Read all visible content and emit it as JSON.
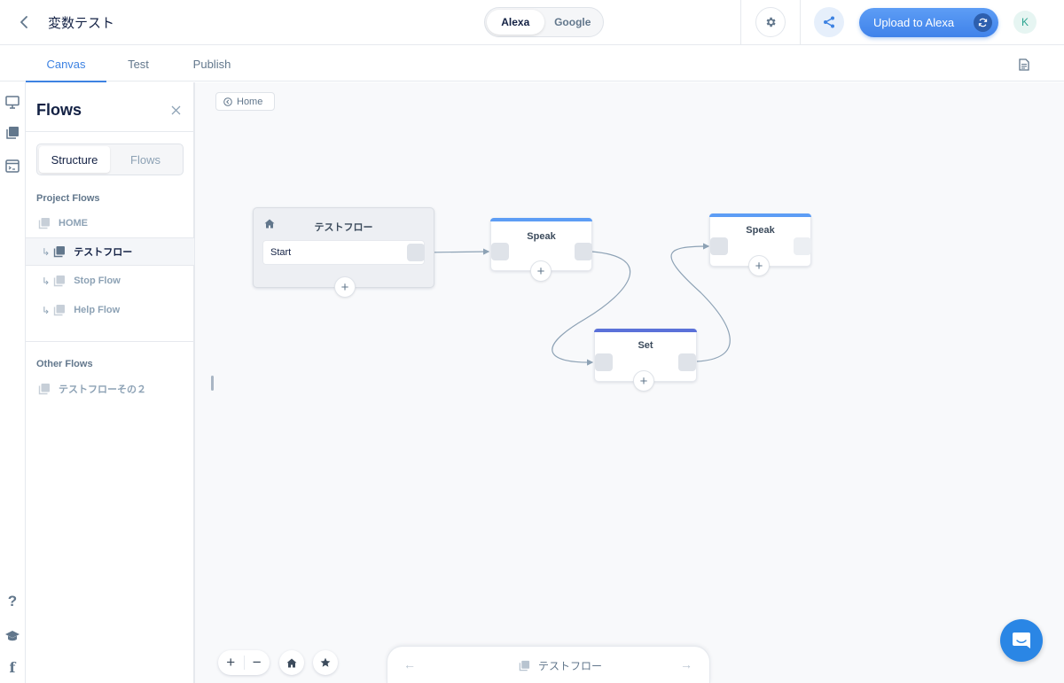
{
  "header": {
    "project_title": "変数テスト",
    "platforms": [
      "Alexa",
      "Google"
    ],
    "active_platform": "Alexa",
    "upload_label": "Upload to Alexa",
    "avatar_initial": "K"
  },
  "tabs": [
    {
      "label": "Canvas",
      "active": true
    },
    {
      "label": "Test",
      "active": false
    },
    {
      "label": "Publish",
      "active": false
    }
  ],
  "panel": {
    "title": "Flows",
    "segments": [
      {
        "label": "Structure",
        "active": true
      },
      {
        "label": "Flows",
        "active": false
      }
    ],
    "project_flows_label": "Project Flows",
    "project_flows": [
      {
        "label": "HOME",
        "selected": false,
        "child": false
      },
      {
        "label": "テストフロー",
        "selected": true,
        "child": true
      },
      {
        "label": "Stop Flow",
        "selected": false,
        "child": true
      },
      {
        "label": "Help Flow",
        "selected": false,
        "child": true
      }
    ],
    "other_flows_label": "Other Flows",
    "other_flows": [
      {
        "label": "テストフローその２"
      }
    ]
  },
  "canvas": {
    "home_chip": "Home",
    "start_block": {
      "title": "テストフロー",
      "row_label": "Start"
    },
    "speak_block_1": {
      "title": "Speak"
    },
    "set_block": {
      "title": "Set"
    },
    "speak_block_2": {
      "title": "Speak"
    }
  },
  "bottom": {
    "current_flow": "テストフロー"
  },
  "colors": {
    "accent": "#3d82e2",
    "speak_bar": "#5d9df5",
    "set_bar": "#5b71d9",
    "chat": "#2a86e5"
  }
}
